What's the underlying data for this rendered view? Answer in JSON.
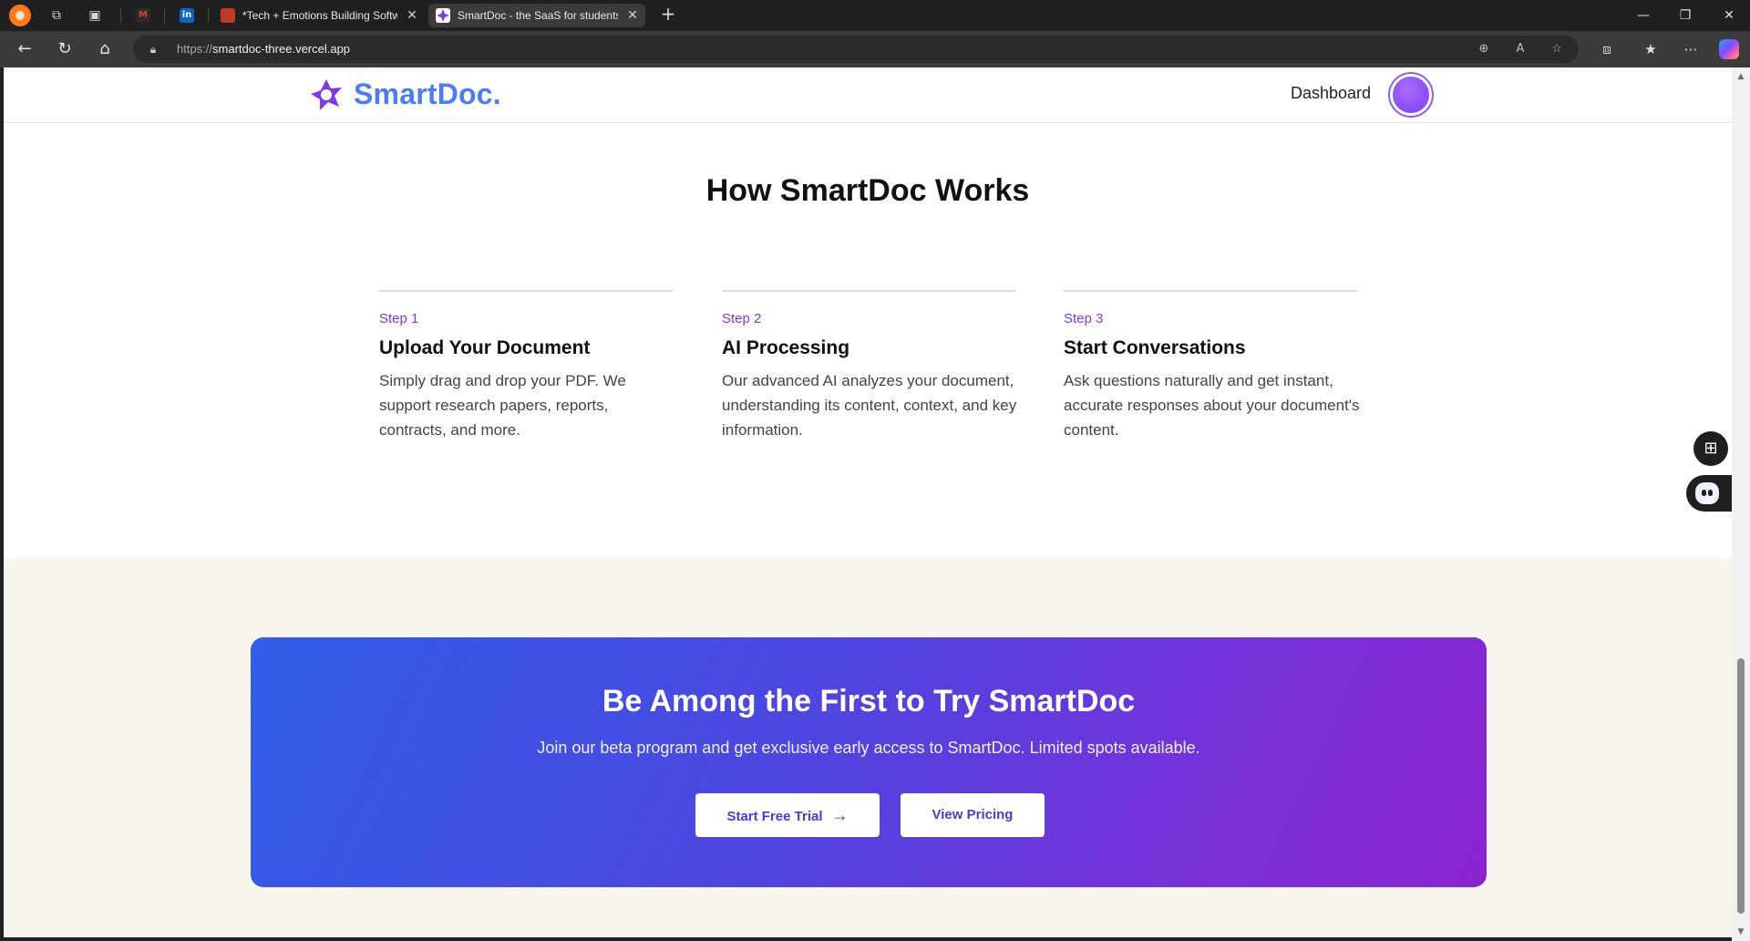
{
  "browser": {
    "tabs": [
      {
        "title": "*Tech + Emotions Building Softwa",
        "active": false
      },
      {
        "title": "SmartDoc - the SaaS for students",
        "active": true
      }
    ],
    "pinned_tabs": [
      {
        "icon": "gmail-icon",
        "glyph": "M"
      },
      {
        "icon": "linkedin-icon",
        "glyph": "in"
      }
    ],
    "address": {
      "protocol": "https://",
      "host": "smartdoc-three.vercel.app"
    },
    "colors": {
      "chrome_bg": "#202020",
      "toolbar_bg": "#3b3b3b"
    }
  },
  "site": {
    "brand": "SmartDoc.",
    "nav": {
      "dashboard": "Dashboard"
    },
    "colors": {
      "brand_blue": "#4a7cf6",
      "accent_purple": "#7c3aed"
    }
  },
  "how": {
    "title": "How SmartDoc Works",
    "steps": [
      {
        "label": "Step 1",
        "title": "Upload Your Document",
        "text": "Simply drag and drop your PDF. We support research papers, reports, contracts, and more."
      },
      {
        "label": "Step 2",
        "title": "AI Processing",
        "text": "Our advanced AI analyzes your document, understanding its content, context, and key information."
      },
      {
        "label": "Step 3",
        "title": "Start Conversations",
        "text": "Ask questions naturally and get instant, accurate responses about your document's content."
      }
    ]
  },
  "cta": {
    "title": "Be Among the First to Try SmartDoc",
    "subtitle": "Join our beta program and get exclusive early access to SmartDoc. Limited spots available.",
    "primary_button": "Start Free Trial",
    "secondary_button": "View Pricing"
  }
}
